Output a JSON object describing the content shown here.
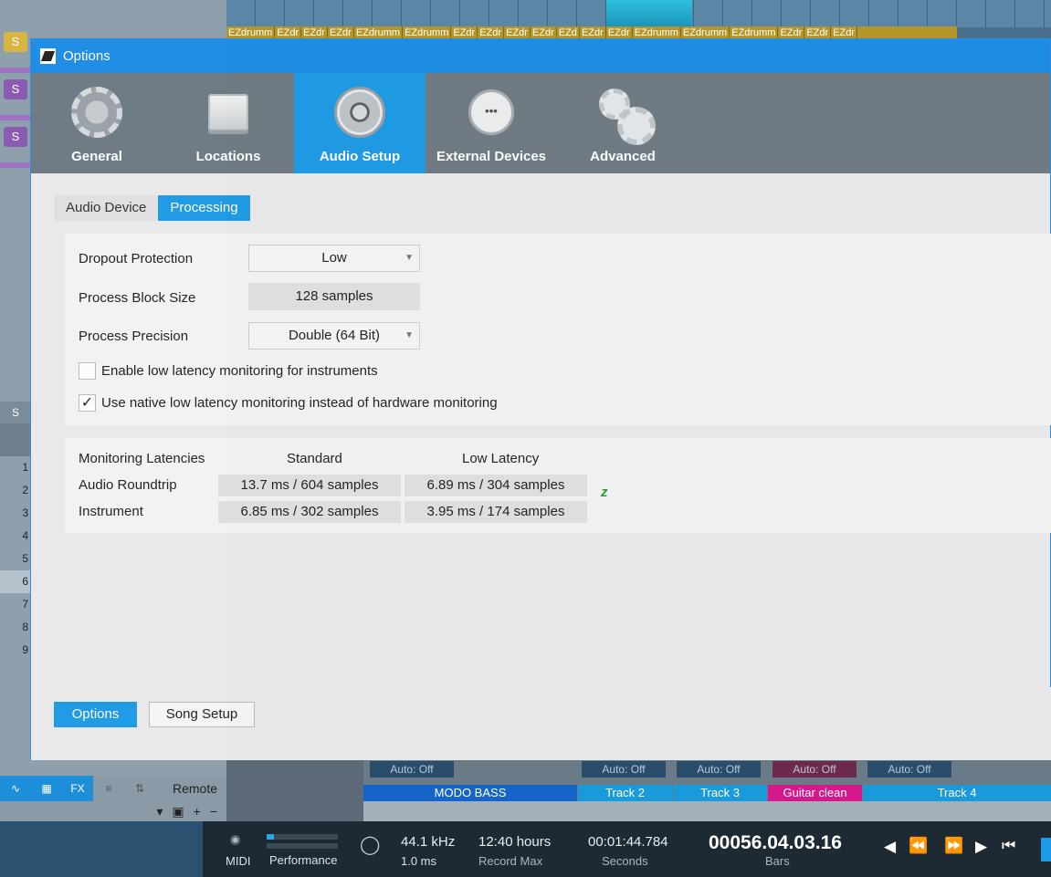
{
  "background": {
    "ez_clips": [
      "EZdrumm",
      "EZdr",
      "EZdr",
      "EZdr",
      "EZdrumm",
      "EZdrumm",
      "EZdr",
      "EZdr",
      "EZdr",
      "EZdr",
      "EZd",
      "EZdr",
      "EZdr",
      "EZdrumm",
      "EZdrumm",
      "EZdrumm",
      "EZdr",
      "EZdr",
      "EZdr"
    ],
    "track_solo_label": "S",
    "track_numbers": [
      "1",
      "2",
      "3",
      "4",
      "5",
      "6",
      "7",
      "8",
      "9"
    ],
    "bottom_left": {
      "fx": "FX",
      "remote": "Remote"
    },
    "mixer": {
      "auto_label": "Auto: Off",
      "channels": [
        "MODO BASS",
        "Track 2",
        "Track 3",
        "Guitar clean",
        "Track 4"
      ]
    },
    "transport": {
      "midi": "MIDI",
      "performance": "Performance",
      "sample_rate": "44.1 kHz",
      "latency": "1.0 ms",
      "record_max_value": "12:40 hours",
      "record_max_label": "Record Max",
      "seconds_value": "00:01:44.784",
      "seconds_label": "Seconds",
      "bars_value": "00056.04.03.16",
      "bars_label": "Bars"
    }
  },
  "dialog": {
    "title": "Options",
    "categories": [
      {
        "label": "General",
        "icon": "gear-icon"
      },
      {
        "label": "Locations",
        "icon": "drive-icon"
      },
      {
        "label": "Audio Setup",
        "icon": "speaker-icon"
      },
      {
        "label": "External Devices",
        "icon": "midi-port-icon"
      },
      {
        "label": "Advanced",
        "icon": "gears-icon"
      }
    ],
    "active_category": "Audio Setup",
    "subtabs": [
      "Audio Device",
      "Processing"
    ],
    "active_subtab": "Processing",
    "processing": {
      "dropout_label": "Dropout Protection",
      "dropout_value": "Low",
      "block_label": "Process Block Size",
      "block_value": "128 samples",
      "precision_label": "Process Precision",
      "precision_value": "Double (64 Bit)",
      "low_latency_label": "Enable low latency monitoring for instruments",
      "low_latency_checked": false,
      "native_label": "Use native low latency monitoring instead of hardware monitoring",
      "native_checked": true
    },
    "latencies": {
      "header": "Monitoring Latencies",
      "col_standard": "Standard",
      "col_low": "Low Latency",
      "rows": [
        {
          "label": "Audio Roundtrip",
          "standard": "13.7 ms / 604 samples",
          "low": "6.89 ms / 304 samples"
        },
        {
          "label": "Instrument",
          "standard": "6.85 ms / 302 samples",
          "low": "3.95 ms / 174 samples"
        }
      ],
      "z_mark": "z"
    },
    "footer": {
      "options": "Options",
      "song_setup": "Song Setup"
    }
  }
}
